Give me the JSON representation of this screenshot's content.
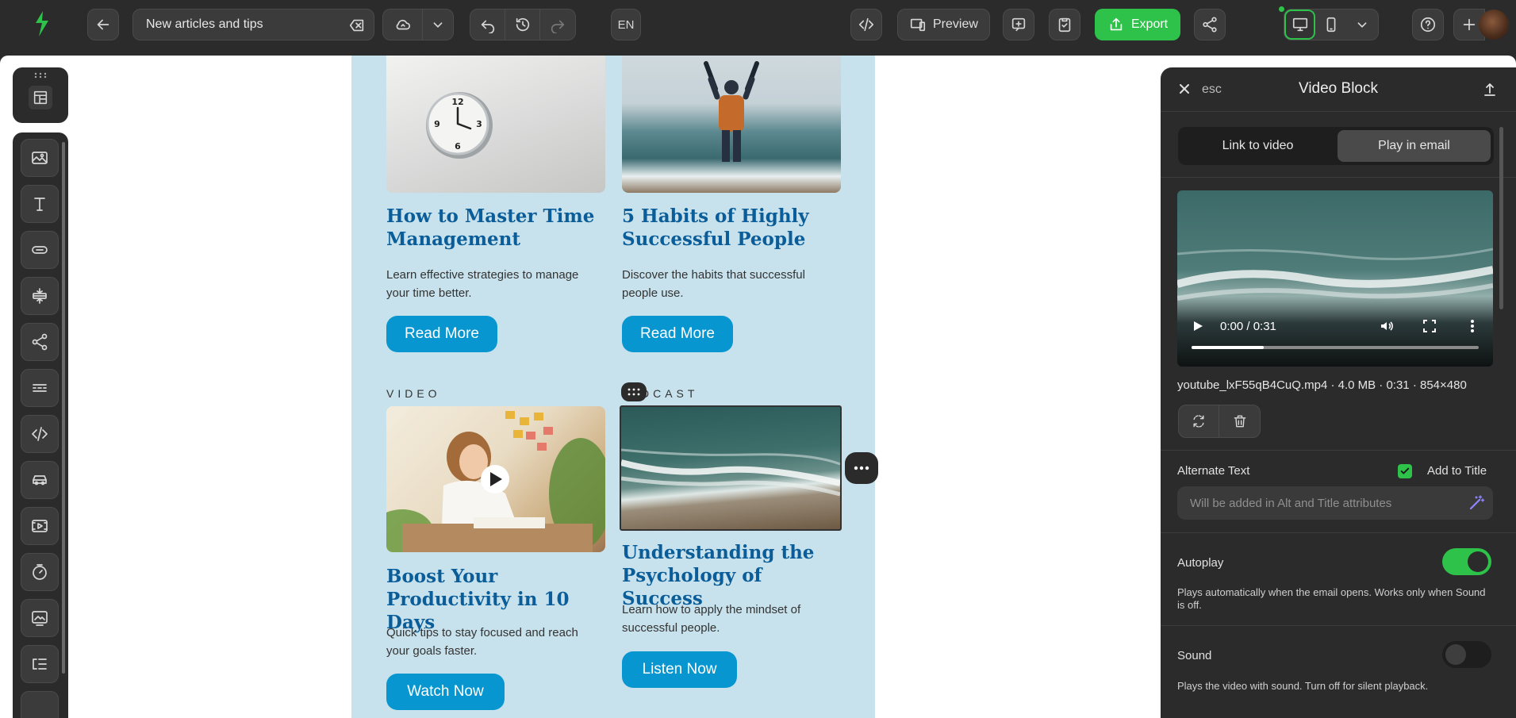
{
  "topbar": {
    "document_title": "New articles and tips",
    "language": "EN",
    "preview_label": "Preview",
    "export_label": "Export",
    "colors": {
      "export": "#2ec24a",
      "active_device_border": "#2ec24a"
    }
  },
  "email": {
    "cards": [
      {
        "title": "How to Master Time Management",
        "text": "Learn effective strategies to manage your time better.",
        "cta": "Read More"
      },
      {
        "title": "5 Habits of Highly Successful People",
        "text": "Discover the habits that successful people use.",
        "cta": "Read More"
      },
      {
        "eyebrow": "VIDEO",
        "title": "Boost Your Productivity in 10 Days",
        "text": "Quick tips to stay focused and reach your goals faster.",
        "cta": "Watch Now"
      },
      {
        "eyebrow": "PODCAST",
        "eyebrow_visible": "DCAST",
        "title": "Understanding the Psychology of Success",
        "text": "Learn how to apply the mindset of successful people.",
        "cta": "Listen Now"
      }
    ],
    "colors": {
      "background": "#c7e2ec",
      "title": "#0a5d98",
      "button": "#0896d0"
    }
  },
  "panel": {
    "esc_label": "esc",
    "title": "Video Block",
    "tabs": [
      {
        "label": "Link to video",
        "active": false
      },
      {
        "label": "Play in email",
        "active": true
      }
    ],
    "video": {
      "time": "0:00 / 0:31",
      "progress_fraction": 0.25
    },
    "file_meta": "youtube_lxF55qB4CuQ.mp4 · 4.0 MB · 0:31 · 854×480",
    "alt_text": {
      "label": "Alternate Text",
      "add_to_title_label": "Add to Title",
      "add_to_title_checked": true,
      "placeholder": "Will be added in Alt and Title attributes"
    },
    "autoplay": {
      "label": "Autoplay",
      "on": true,
      "help": "Plays automatically when the email opens. Works only when Sound is off."
    },
    "sound": {
      "label": "Sound",
      "on": false,
      "help": "Plays the video with sound. Turn off for silent playback."
    }
  }
}
